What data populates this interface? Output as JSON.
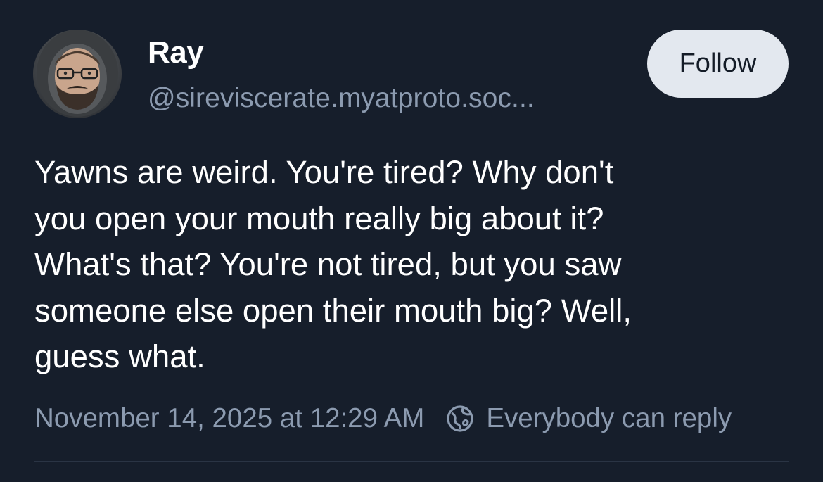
{
  "author": {
    "display_name": "Ray",
    "handle": "@sireviscerate.myatproto.soc..."
  },
  "follow_button": {
    "label": "Follow"
  },
  "post": {
    "lines": [
      "Yawns are weird. You're tired? Why don't",
      "you open your mouth really big about it?",
      "What's that? You're not tired, but you saw",
      "someone else open their mouth big? Well,",
      "guess what."
    ]
  },
  "meta": {
    "timestamp": "November 14, 2025 at 12:29 AM",
    "reply_setting": "Everybody can reply",
    "reply_icon": "globe-icon"
  },
  "colors": {
    "background": "#161e2b",
    "muted_text": "#8c9bb0",
    "button_bg": "#e3e8ef"
  }
}
